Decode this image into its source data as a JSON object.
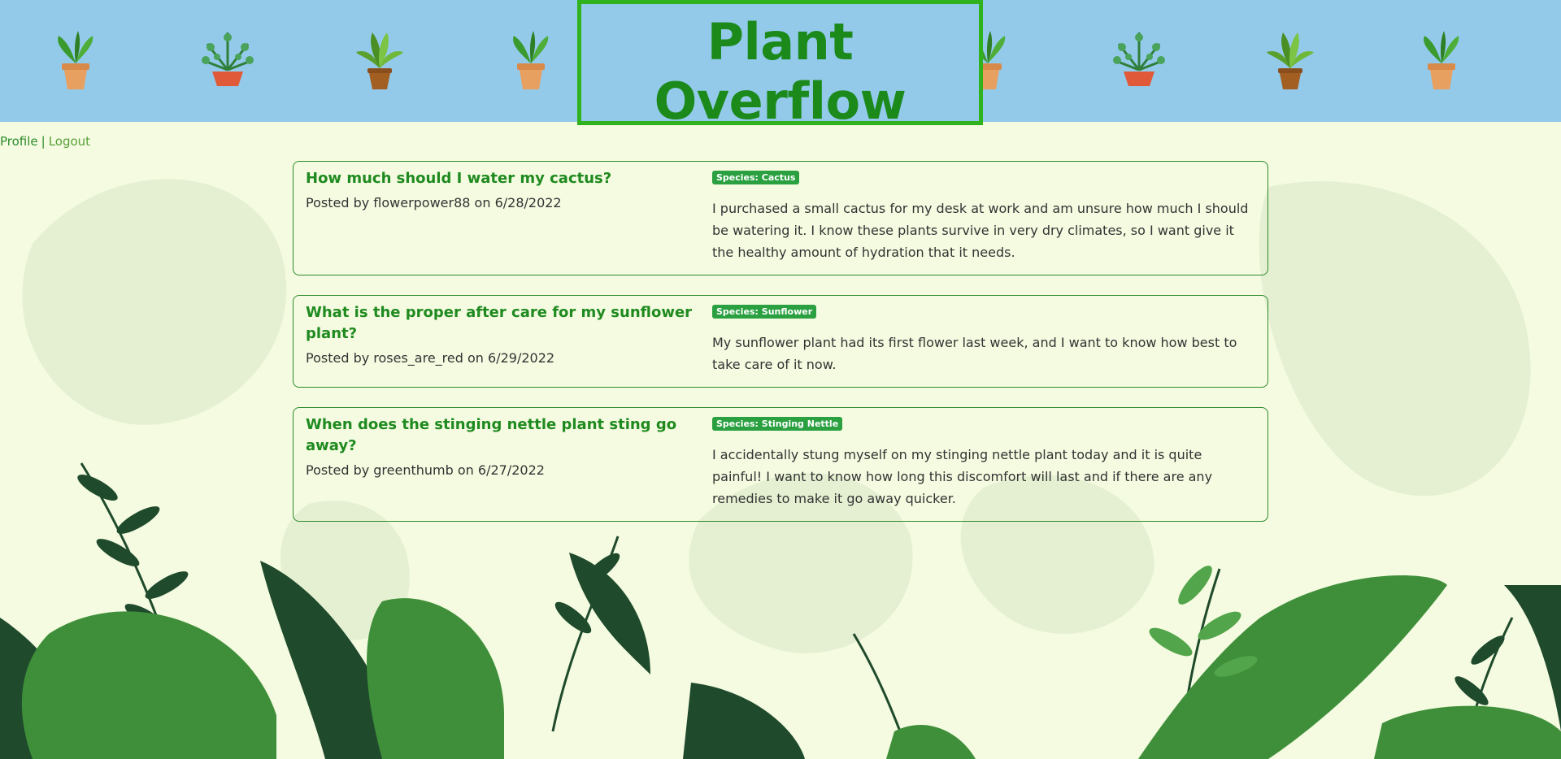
{
  "header": {
    "title": "Plant Overflow",
    "plant_icons": [
      "potted-plant-icon",
      "fern-plant-icon",
      "palm-plant-icon",
      "potted-plant-icon",
      "potted-plant-icon",
      "fern-plant-icon",
      "palm-plant-icon",
      "potted-plant-icon"
    ]
  },
  "nav": {
    "profile_label": "Profile",
    "separator": "|",
    "logout_label": "Logout"
  },
  "posts": [
    {
      "title": "How much should I water my cactus?",
      "meta": "Posted by flowerpower88 on 6/28/2022",
      "species": "Species: Cactus",
      "body": "I purchased a small cactus for my desk at work and am unsure how much I should be watering it. I know these plants survive in very dry climates, so I want give it the healthy amount of hydration that it needs."
    },
    {
      "title": "What is the proper after care for my sunflower plant?",
      "meta": "Posted by roses_are_red on 6/29/2022",
      "species": "Species: Sunflower",
      "body": "My sunflower plant had its first flower last week, and I want to know how best to take care of it now."
    },
    {
      "title": "When does the stinging nettle plant sting go away?",
      "meta": "Posted by greenthumb on 6/27/2022",
      "species": "Species: Stinging Nettle",
      "body": "I accidentally stung myself on my stinging nettle plant today and it is quite painful! I want to know how long this discomfort will last and if there are any remedies to make it go away quicker."
    }
  ],
  "colors": {
    "header_bg": "#93caea",
    "title_green": "#1b8a1b",
    "title_border": "#2fb21c",
    "page_bg": "#f4fbe0",
    "badge_green": "#2aa040",
    "card_border": "#2e8b2e"
  }
}
